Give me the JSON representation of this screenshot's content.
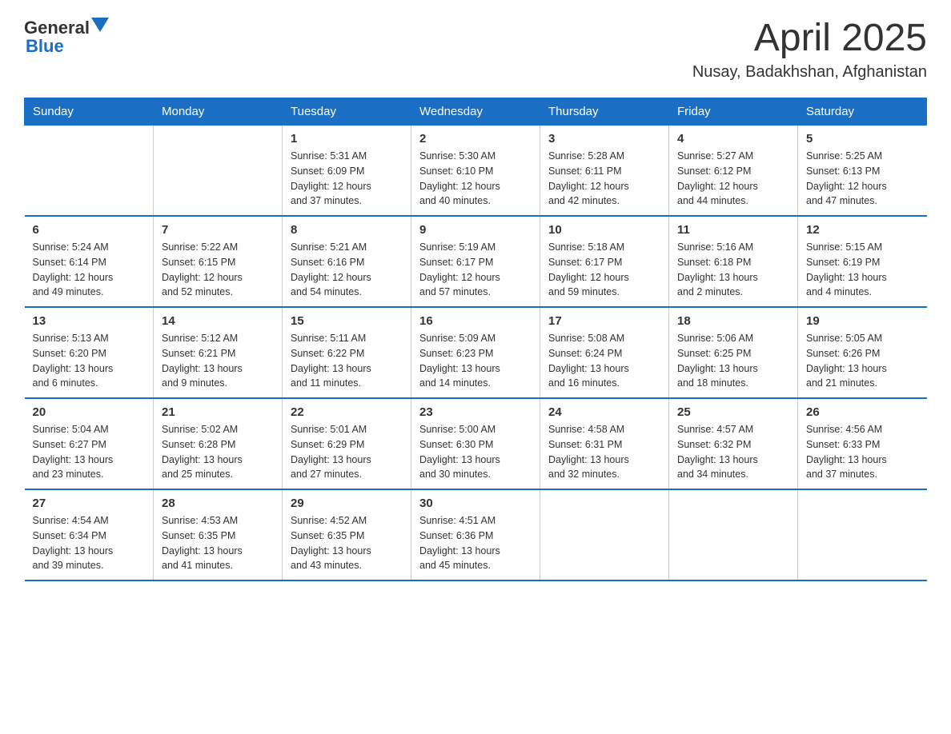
{
  "header": {
    "logo_general": "General",
    "logo_blue": "Blue",
    "month_title": "April 2025",
    "location": "Nusay, Badakhshan, Afghanistan"
  },
  "days_of_week": [
    "Sunday",
    "Monday",
    "Tuesday",
    "Wednesday",
    "Thursday",
    "Friday",
    "Saturday"
  ],
  "weeks": [
    [
      {
        "day": "",
        "info": ""
      },
      {
        "day": "",
        "info": ""
      },
      {
        "day": "1",
        "info": "Sunrise: 5:31 AM\nSunset: 6:09 PM\nDaylight: 12 hours\nand 37 minutes."
      },
      {
        "day": "2",
        "info": "Sunrise: 5:30 AM\nSunset: 6:10 PM\nDaylight: 12 hours\nand 40 minutes."
      },
      {
        "day": "3",
        "info": "Sunrise: 5:28 AM\nSunset: 6:11 PM\nDaylight: 12 hours\nand 42 minutes."
      },
      {
        "day": "4",
        "info": "Sunrise: 5:27 AM\nSunset: 6:12 PM\nDaylight: 12 hours\nand 44 minutes."
      },
      {
        "day": "5",
        "info": "Sunrise: 5:25 AM\nSunset: 6:13 PM\nDaylight: 12 hours\nand 47 minutes."
      }
    ],
    [
      {
        "day": "6",
        "info": "Sunrise: 5:24 AM\nSunset: 6:14 PM\nDaylight: 12 hours\nand 49 minutes."
      },
      {
        "day": "7",
        "info": "Sunrise: 5:22 AM\nSunset: 6:15 PM\nDaylight: 12 hours\nand 52 minutes."
      },
      {
        "day": "8",
        "info": "Sunrise: 5:21 AM\nSunset: 6:16 PM\nDaylight: 12 hours\nand 54 minutes."
      },
      {
        "day": "9",
        "info": "Sunrise: 5:19 AM\nSunset: 6:17 PM\nDaylight: 12 hours\nand 57 minutes."
      },
      {
        "day": "10",
        "info": "Sunrise: 5:18 AM\nSunset: 6:17 PM\nDaylight: 12 hours\nand 59 minutes."
      },
      {
        "day": "11",
        "info": "Sunrise: 5:16 AM\nSunset: 6:18 PM\nDaylight: 13 hours\nand 2 minutes."
      },
      {
        "day": "12",
        "info": "Sunrise: 5:15 AM\nSunset: 6:19 PM\nDaylight: 13 hours\nand 4 minutes."
      }
    ],
    [
      {
        "day": "13",
        "info": "Sunrise: 5:13 AM\nSunset: 6:20 PM\nDaylight: 13 hours\nand 6 minutes."
      },
      {
        "day": "14",
        "info": "Sunrise: 5:12 AM\nSunset: 6:21 PM\nDaylight: 13 hours\nand 9 minutes."
      },
      {
        "day": "15",
        "info": "Sunrise: 5:11 AM\nSunset: 6:22 PM\nDaylight: 13 hours\nand 11 minutes."
      },
      {
        "day": "16",
        "info": "Sunrise: 5:09 AM\nSunset: 6:23 PM\nDaylight: 13 hours\nand 14 minutes."
      },
      {
        "day": "17",
        "info": "Sunrise: 5:08 AM\nSunset: 6:24 PM\nDaylight: 13 hours\nand 16 minutes."
      },
      {
        "day": "18",
        "info": "Sunrise: 5:06 AM\nSunset: 6:25 PM\nDaylight: 13 hours\nand 18 minutes."
      },
      {
        "day": "19",
        "info": "Sunrise: 5:05 AM\nSunset: 6:26 PM\nDaylight: 13 hours\nand 21 minutes."
      }
    ],
    [
      {
        "day": "20",
        "info": "Sunrise: 5:04 AM\nSunset: 6:27 PM\nDaylight: 13 hours\nand 23 minutes."
      },
      {
        "day": "21",
        "info": "Sunrise: 5:02 AM\nSunset: 6:28 PM\nDaylight: 13 hours\nand 25 minutes."
      },
      {
        "day": "22",
        "info": "Sunrise: 5:01 AM\nSunset: 6:29 PM\nDaylight: 13 hours\nand 27 minutes."
      },
      {
        "day": "23",
        "info": "Sunrise: 5:00 AM\nSunset: 6:30 PM\nDaylight: 13 hours\nand 30 minutes."
      },
      {
        "day": "24",
        "info": "Sunrise: 4:58 AM\nSunset: 6:31 PM\nDaylight: 13 hours\nand 32 minutes."
      },
      {
        "day": "25",
        "info": "Sunrise: 4:57 AM\nSunset: 6:32 PM\nDaylight: 13 hours\nand 34 minutes."
      },
      {
        "day": "26",
        "info": "Sunrise: 4:56 AM\nSunset: 6:33 PM\nDaylight: 13 hours\nand 37 minutes."
      }
    ],
    [
      {
        "day": "27",
        "info": "Sunrise: 4:54 AM\nSunset: 6:34 PM\nDaylight: 13 hours\nand 39 minutes."
      },
      {
        "day": "28",
        "info": "Sunrise: 4:53 AM\nSunset: 6:35 PM\nDaylight: 13 hours\nand 41 minutes."
      },
      {
        "day": "29",
        "info": "Sunrise: 4:52 AM\nSunset: 6:35 PM\nDaylight: 13 hours\nand 43 minutes."
      },
      {
        "day": "30",
        "info": "Sunrise: 4:51 AM\nSunset: 6:36 PM\nDaylight: 13 hours\nand 45 minutes."
      },
      {
        "day": "",
        "info": ""
      },
      {
        "day": "",
        "info": ""
      },
      {
        "day": "",
        "info": ""
      }
    ]
  ]
}
